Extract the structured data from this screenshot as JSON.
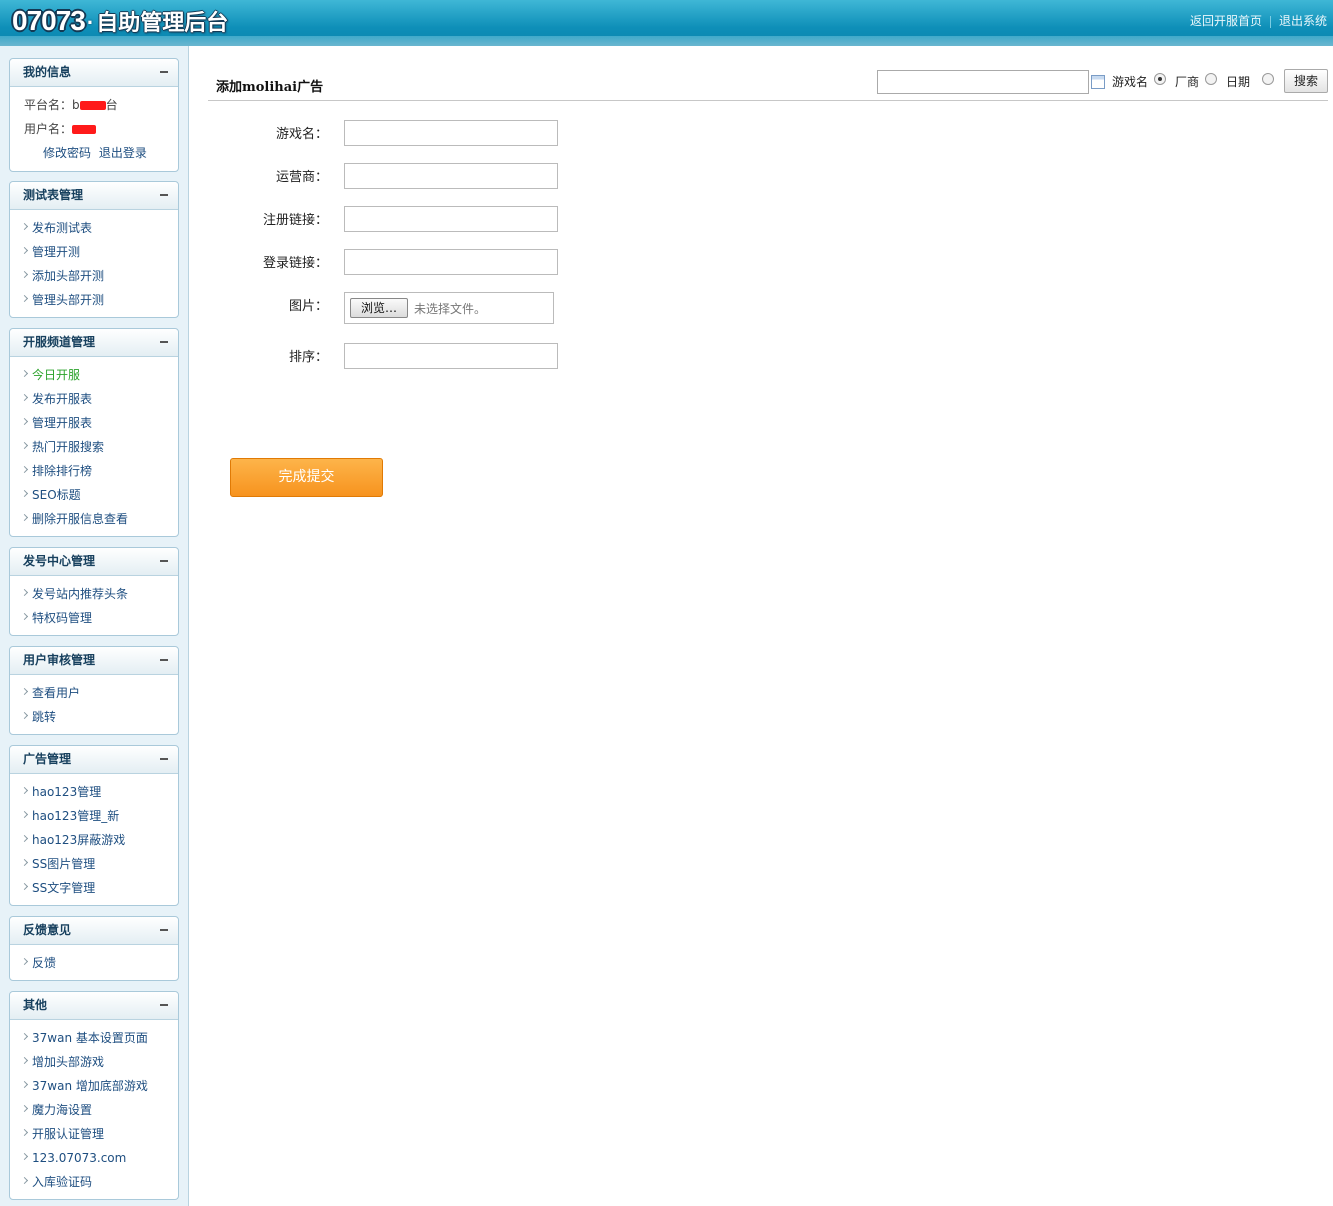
{
  "header": {
    "logo_num": "07073",
    "logo_dot": "·",
    "logo_text": "自助管理后台",
    "links": [
      "返回开服首页",
      "退出系统"
    ]
  },
  "sidebar": {
    "my_info": {
      "title": "我的信息",
      "platform_label": "平台名：",
      "platform_value_visible": "b",
      "platform_value_suffix": "台",
      "user_label": "用户名：",
      "links": [
        "修改密码",
        "退出登录"
      ]
    },
    "groups": [
      {
        "title": "测试表管理",
        "items": [
          "发布测试表",
          "管理开测",
          "添加头部开测",
          "管理头部开测"
        ]
      },
      {
        "title": "开服频道管理",
        "items": [
          "今日开服",
          "发布开服表",
          "管理开服表",
          "热门开服搜索",
          "排除排行榜",
          "SEO标题",
          "删除开服信息查看"
        ]
      },
      {
        "title": "发号中心管理",
        "items": [
          "发号站内推荐头条",
          "特权码管理"
        ]
      },
      {
        "title": "用户审核管理",
        "items": [
          "查看用户",
          "跳转"
        ]
      },
      {
        "title": "广告管理",
        "items": [
          "hao123管理",
          "hao123管理_新",
          "hao123屏蔽游戏",
          "SS图片管理",
          "SS文字管理"
        ]
      },
      {
        "title": "反馈意见",
        "items": [
          "反馈"
        ]
      },
      {
        "title": "其他",
        "items": [
          "37wan 基本设置页面",
          "增加头部游戏",
          "37wan 增加底部游戏",
          "魔力海设置",
          "开服认证管理",
          "123.07073.com",
          "入库验证码"
        ]
      }
    ],
    "active_item": "今日开服"
  },
  "main": {
    "title": "添加molihai广告",
    "search": {
      "value": "",
      "options": [
        "游戏名",
        "厂商",
        "日期"
      ],
      "selected": "游戏名",
      "button": "搜索"
    },
    "form": {
      "fields": [
        {
          "label": "游戏名：",
          "value": ""
        },
        {
          "label": "运营商：",
          "value": ""
        },
        {
          "label": "注册链接：",
          "value": ""
        },
        {
          "label": "登录链接：",
          "value": ""
        }
      ],
      "image": {
        "label": "图片：",
        "browse": "浏览…",
        "no_file": "未选择文件。"
      },
      "sort": {
        "label": "排序：",
        "value": ""
      },
      "submit": "完成提交"
    }
  },
  "colors": {
    "header": "#0e8fb8",
    "sidebar_bg": "#e7f2f8",
    "link": "#1e4e80",
    "active_link": "#2aa22a",
    "submit": "#f7931e",
    "redaction": "#ff1a1a"
  }
}
